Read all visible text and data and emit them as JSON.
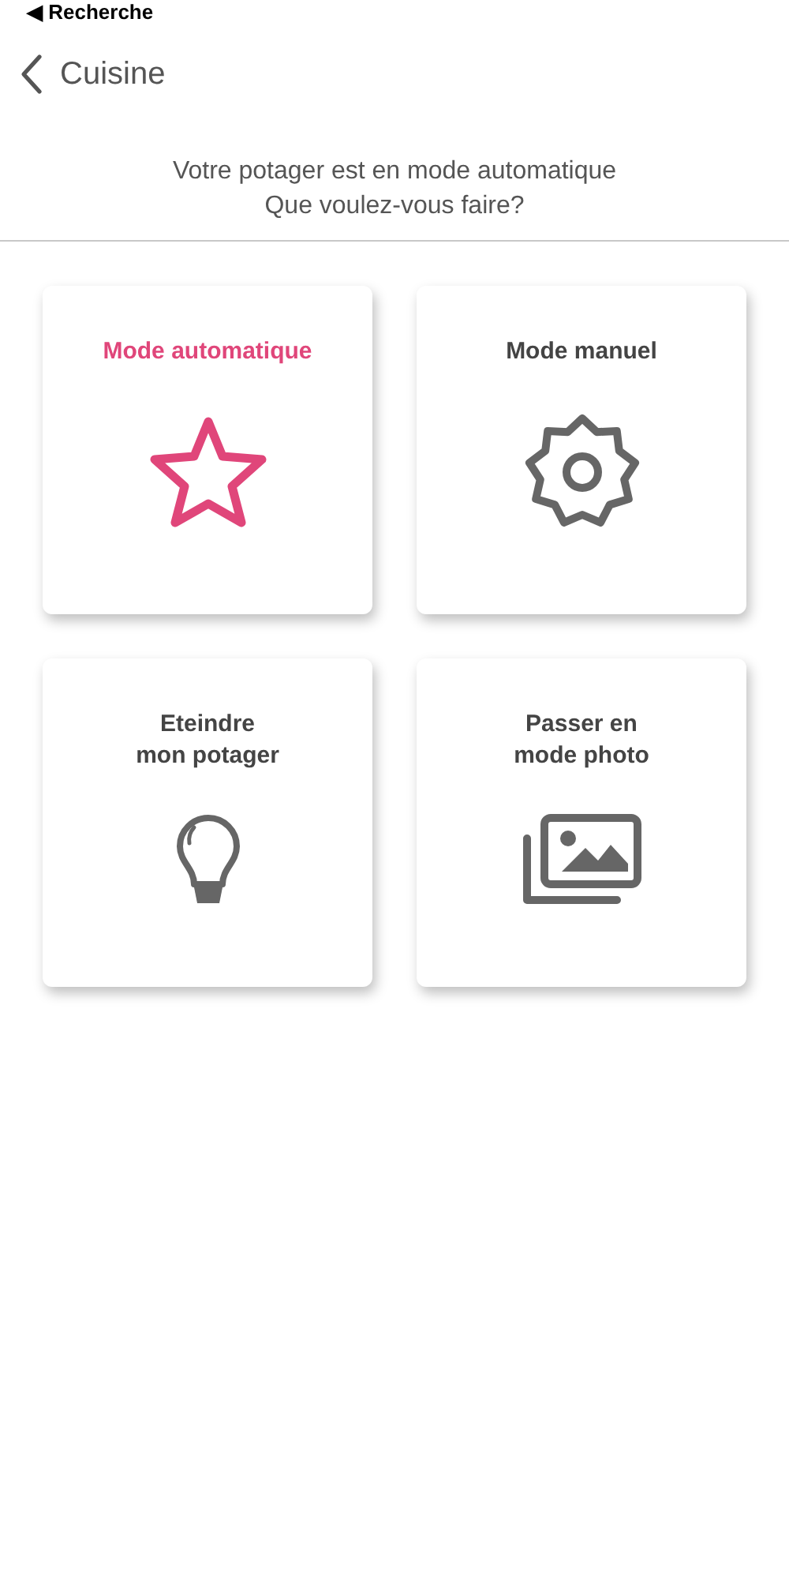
{
  "status_bar": {
    "back_app": "◀ Recherche"
  },
  "nav": {
    "title": "Cuisine"
  },
  "prompt": "Votre potager est en mode automatique\nQue voulez-vous faire?",
  "options": [
    {
      "label": "Mode automatique",
      "kind": "star",
      "selected": true
    },
    {
      "label": "Mode manuel",
      "kind": "gear",
      "selected": false
    },
    {
      "label": "Eteindre\nmon potager",
      "kind": "bulb",
      "selected": false
    },
    {
      "label": "Passer en\nmode photo",
      "kind": "photos",
      "selected": false
    }
  ]
}
